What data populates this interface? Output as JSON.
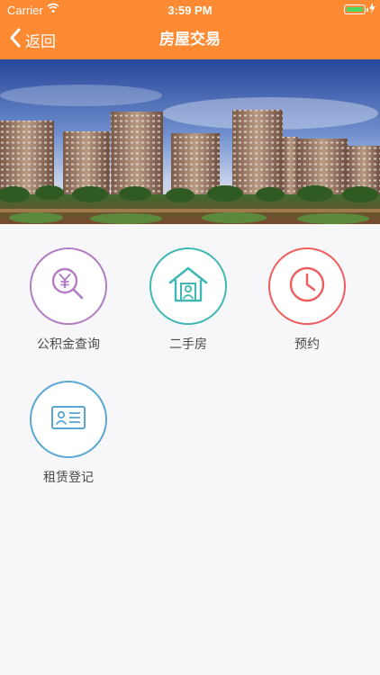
{
  "status_bar": {
    "carrier": "Carrier",
    "time": "3:59 PM"
  },
  "nav": {
    "back_label": "返回",
    "title": "房屋交易"
  },
  "colors": {
    "header": "#ff8a34",
    "fund": "#b27cc5",
    "house": "#3fb7b2",
    "appointment": "#ee5d5d",
    "rental": "#5aa7d5"
  },
  "menu": [
    {
      "label": "公积金查询",
      "icon": "yuan-search-icon"
    },
    {
      "label": "二手房",
      "icon": "house-person-icon"
    },
    {
      "label": "预约",
      "icon": "clock-icon"
    },
    {
      "label": "租赁登记",
      "icon": "id-card-icon"
    }
  ]
}
